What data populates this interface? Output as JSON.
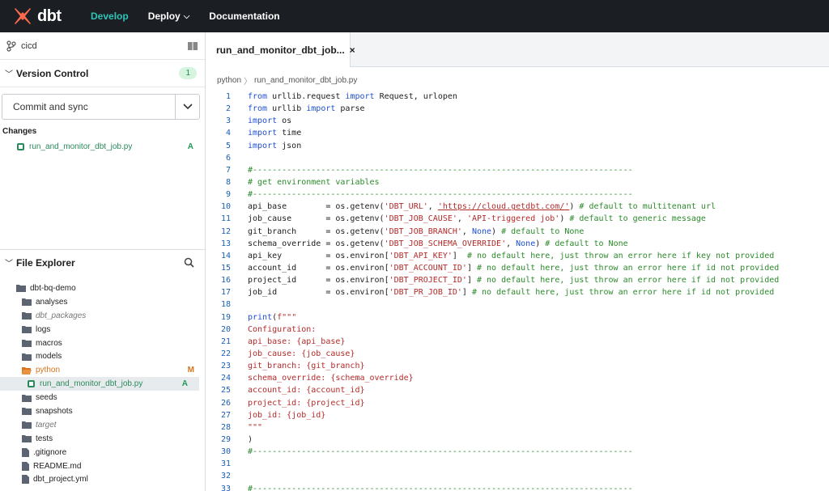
{
  "nav": {
    "brand": "dbt",
    "items": [
      {
        "label": "Develop",
        "active": true
      },
      {
        "label": "Deploy",
        "active": false,
        "has_caret": true
      },
      {
        "label": "Documentation",
        "active": false
      }
    ],
    "accent": "#2ec4b6",
    "logo_color": "#ff694b"
  },
  "sidebar": {
    "branch": "cicd",
    "version_control": {
      "title": "Version Control",
      "badge": "1"
    },
    "commit_label": "Commit and sync",
    "changes_title": "Changes",
    "changes": [
      {
        "name": "run_and_monitor_dbt_job.py",
        "status": "A"
      }
    ],
    "file_explorer": {
      "title": "File Explorer",
      "items": [
        {
          "name": "dbt-bq-demo",
          "type": "folder",
          "depth": 0
        },
        {
          "name": "analyses",
          "type": "folder",
          "depth": 1
        },
        {
          "name": "dbt_packages",
          "type": "folder",
          "depth": 1,
          "muted": true
        },
        {
          "name": "logs",
          "type": "folder",
          "depth": 1
        },
        {
          "name": "macros",
          "type": "folder",
          "depth": 1
        },
        {
          "name": "models",
          "type": "folder",
          "depth": 1
        },
        {
          "name": "python",
          "type": "folder-open",
          "depth": 1,
          "status": "M"
        },
        {
          "name": "run_and_monitor_dbt_job.py",
          "type": "pyfile",
          "depth": 2,
          "status": "A",
          "selected": true
        },
        {
          "name": "seeds",
          "type": "folder",
          "depth": 1
        },
        {
          "name": "snapshots",
          "type": "folder",
          "depth": 1
        },
        {
          "name": "target",
          "type": "folder",
          "depth": 1,
          "muted": true
        },
        {
          "name": "tests",
          "type": "folder",
          "depth": 1
        },
        {
          "name": ".gitignore",
          "type": "file",
          "depth": 1
        },
        {
          "name": "README.md",
          "type": "file",
          "depth": 1
        },
        {
          "name": "dbt_project.yml",
          "type": "file",
          "depth": 1
        }
      ]
    }
  },
  "editor": {
    "tab_title": "run_and_monitor_dbt_job...",
    "close_glyph": "×",
    "breadcrumb": [
      "python",
      "run_and_monitor_dbt_job.py"
    ],
    "lines": [
      [
        [
          "kw",
          "from"
        ],
        [
          "t",
          " urllib.request "
        ],
        [
          "kw",
          "import"
        ],
        [
          "t",
          " Request, urlopen"
        ]
      ],
      [
        [
          "kw",
          "from"
        ],
        [
          "t",
          " urllib "
        ],
        [
          "kw",
          "import"
        ],
        [
          "t",
          " parse"
        ]
      ],
      [
        [
          "kw",
          "import"
        ],
        [
          "t",
          " os"
        ]
      ],
      [
        [
          "kw",
          "import"
        ],
        [
          "t",
          " time"
        ]
      ],
      [
        [
          "kw",
          "import"
        ],
        [
          "t",
          " json"
        ]
      ],
      [],
      [
        [
          "cm",
          "#------------------------------------------------------------------------------"
        ]
      ],
      [
        [
          "cm",
          "# get environment variables"
        ]
      ],
      [
        [
          "cm",
          "#------------------------------------------------------------------------------"
        ]
      ],
      [
        [
          "t",
          "api_base        = os.getenv("
        ],
        [
          "str",
          "'DBT_URL'"
        ],
        [
          "t",
          ", "
        ],
        [
          "url",
          "'https://cloud.getdbt.com/'"
        ],
        [
          "t",
          ") "
        ],
        [
          "cm",
          "# default to multitenant url"
        ]
      ],
      [
        [
          "t",
          "job_cause       = os.getenv("
        ],
        [
          "str",
          "'DBT_JOB_CAUSE'"
        ],
        [
          "t",
          ", "
        ],
        [
          "str",
          "'API-triggered job'"
        ],
        [
          "t",
          ") "
        ],
        [
          "cm",
          "# default to generic message"
        ]
      ],
      [
        [
          "t",
          "git_branch      = os.getenv("
        ],
        [
          "str",
          "'DBT_JOB_BRANCH'"
        ],
        [
          "t",
          ", "
        ],
        [
          "kw",
          "None"
        ],
        [
          "t",
          ") "
        ],
        [
          "cm",
          "# default to None"
        ]
      ],
      [
        [
          "t",
          "schema_override = os.getenv("
        ],
        [
          "str",
          "'DBT_JOB_SCHEMA_OVERRIDE'"
        ],
        [
          "t",
          ", "
        ],
        [
          "kw",
          "None"
        ],
        [
          "t",
          ") "
        ],
        [
          "cm",
          "# default to None"
        ]
      ],
      [
        [
          "t",
          "api_key         = os.environ["
        ],
        [
          "str",
          "'DBT_API_KEY'"
        ],
        [
          "t",
          "]  "
        ],
        [
          "cm",
          "# no default here, just throw an error here if key not provided"
        ]
      ],
      [
        [
          "t",
          "account_id      = os.environ["
        ],
        [
          "str",
          "'DBT_ACCOUNT_ID'"
        ],
        [
          "t",
          "] "
        ],
        [
          "cm",
          "# no default here, just throw an error here if id not provided"
        ]
      ],
      [
        [
          "t",
          "project_id      = os.environ["
        ],
        [
          "str",
          "'DBT_PROJECT_ID'"
        ],
        [
          "t",
          "] "
        ],
        [
          "cm",
          "# no default here, just throw an error here if id not provided"
        ]
      ],
      [
        [
          "t",
          "job_id          = os.environ["
        ],
        [
          "str",
          "'DBT_PR_JOB_ID'"
        ],
        [
          "t",
          "] "
        ],
        [
          "cm",
          "# no default here, just throw an error here if id not provided"
        ]
      ],
      [],
      [
        [
          "kw",
          "print"
        ],
        [
          "t",
          "("
        ],
        [
          "str",
          "f\"\"\""
        ]
      ],
      [
        [
          "str",
          "Configuration:"
        ]
      ],
      [
        [
          "str",
          "api_base: {api_base}"
        ]
      ],
      [
        [
          "str",
          "job_cause: {job_cause}"
        ]
      ],
      [
        [
          "str",
          "git_branch: {git_branch}"
        ]
      ],
      [
        [
          "str",
          "schema_override: {schema_override}"
        ]
      ],
      [
        [
          "str",
          "account_id: {account_id}"
        ]
      ],
      [
        [
          "str",
          "project_id: {project_id}"
        ]
      ],
      [
        [
          "str",
          "job_id: {job_id}"
        ]
      ],
      [
        [
          "str",
          "\"\"\""
        ]
      ],
      [
        [
          "t",
          ")"
        ]
      ],
      [
        [
          "cm",
          "#------------------------------------------------------------------------------"
        ]
      ],
      [],
      [],
      [
        [
          "cm",
          "#------------------------------------------------------------------------------"
        ]
      ]
    ]
  }
}
